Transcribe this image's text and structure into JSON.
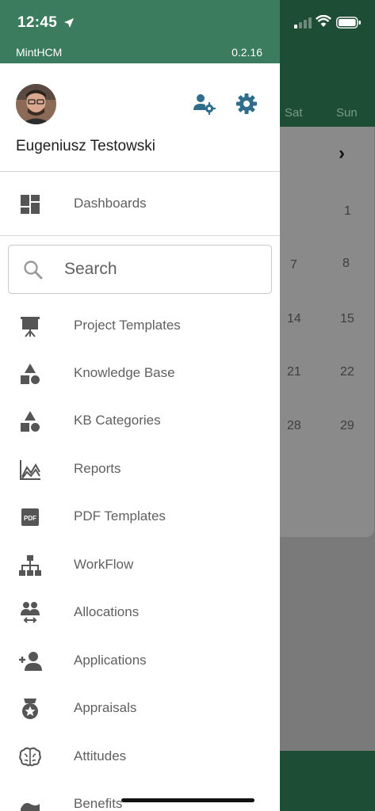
{
  "status_bar": {
    "time": "12:45",
    "icons": [
      "location-arrow-icon",
      "cellular-signal-icon",
      "wifi-icon",
      "battery-icon"
    ]
  },
  "app": {
    "name": "MintHCM",
    "version": "0.2.16"
  },
  "user": {
    "name": "Eugeniusz Testowski",
    "avatar_icon": "avatar"
  },
  "profile_actions": [
    {
      "name": "user-settings-icon"
    },
    {
      "name": "settings-gear-icon"
    }
  ],
  "dashboards": {
    "label": "Dashboards",
    "icon": "dashboard-icon"
  },
  "search": {
    "placeholder": "Search"
  },
  "menu": [
    {
      "label": "Project Templates",
      "icon": "presentation-icon"
    },
    {
      "label": "Knowledge Base",
      "icon": "shapes-icon"
    },
    {
      "label": "KB Categories",
      "icon": "shapes-icon"
    },
    {
      "label": "Reports",
      "icon": "area-chart-icon"
    },
    {
      "label": "PDF Templates",
      "icon": "pdf-icon"
    },
    {
      "label": "WorkFlow",
      "icon": "sitemap-icon"
    },
    {
      "label": "Allocations",
      "icon": "people-arrows-icon"
    },
    {
      "label": "Applications",
      "icon": "person-add-icon"
    },
    {
      "label": "Appraisals",
      "icon": "medal-icon"
    },
    {
      "label": "Attitudes",
      "icon": "brain-icon"
    },
    {
      "label": "Benefits",
      "icon": "benefits-icon"
    }
  ],
  "background_calendar": {
    "weekdays": [
      "Sat",
      "Sun"
    ],
    "rows": [
      [
        "",
        "1"
      ],
      [
        "7",
        "8"
      ],
      [
        "14",
        "15"
      ],
      [
        "21",
        "22"
      ],
      [
        "28",
        "29"
      ]
    ]
  },
  "colors": {
    "drawer_header": "#3a7c5d",
    "background_header": "#1e4d36",
    "icon_accent": "#2f6d8c",
    "menu_text": "#606060"
  }
}
